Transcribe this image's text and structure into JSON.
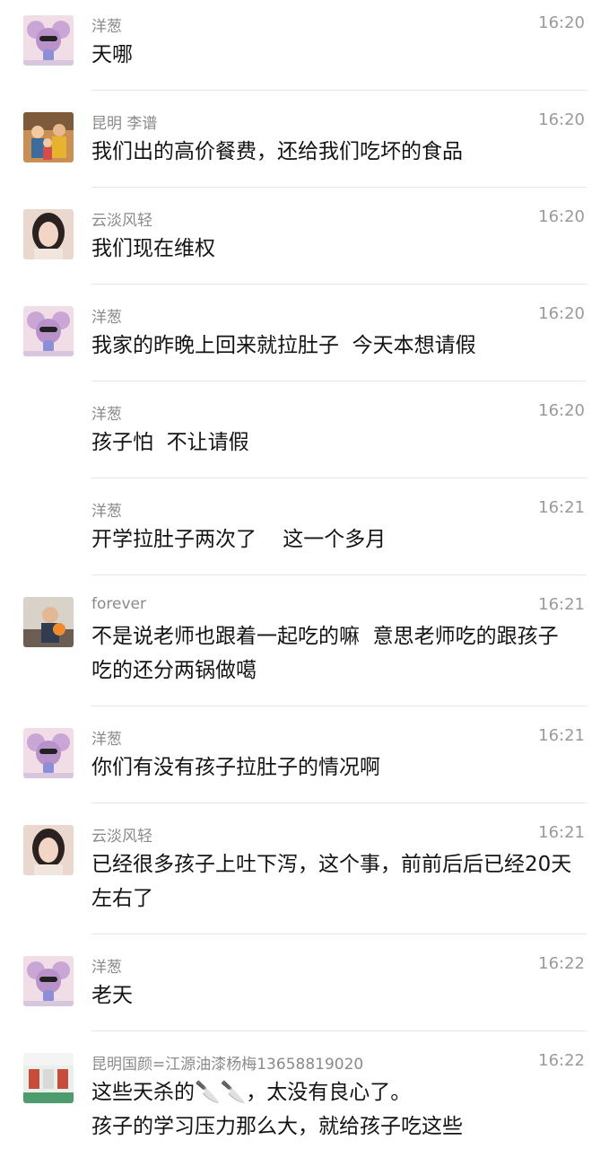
{
  "messages": [
    {
      "sender": "洋葱",
      "time": "16:20",
      "text": "天哪",
      "avatar": "mouse-avatar"
    },
    {
      "sender": "昆明 李谱",
      "time": "16:20",
      "text": "我们出的高价餐费，还给我们吃坏的食品",
      "avatar": "family-photo-avatar"
    },
    {
      "sender": "云淡风轻",
      "time": "16:20",
      "text": "我们现在维权",
      "avatar": "woman-photo-avatar"
    },
    {
      "sender": "洋葱",
      "time": "16:20",
      "text": "我家的昨晚上回来就拉肚子  今天本想请假",
      "avatar": "mouse-avatar"
    },
    {
      "sender": "洋葱",
      "time": "16:20",
      "text": "孩子怕  不让请假",
      "avatar": ""
    },
    {
      "sender": "洋葱",
      "time": "16:21",
      "text": "开学拉肚子两次了    这一个多月",
      "avatar": ""
    },
    {
      "sender": "forever",
      "time": "16:21",
      "text": "不是说老师也跟着一起吃的嘛  意思老师吃的跟孩子吃的还分两锅做噶",
      "avatar": "child-photo-avatar"
    },
    {
      "sender": "洋葱",
      "time": "16:21",
      "text": "你们有没有孩子拉肚子的情况啊",
      "avatar": "mouse-avatar"
    },
    {
      "sender": "云淡风轻",
      "time": "16:21",
      "text": "已经很多孩子上吐下泻，这个事，前前后后已经20天左右了",
      "avatar": "woman-photo-avatar"
    },
    {
      "sender": "洋葱",
      "time": "16:22",
      "text": "老天",
      "avatar": "mouse-avatar"
    },
    {
      "sender": "昆明国颜=江源油漆杨梅13658819020",
      "time": "16:22",
      "text": "这些天杀的🔪🔪，太没有良心了。\n孩子的学习压力那么大，就给孩子吃这些",
      "avatar": "paint-shop-avatar"
    }
  ]
}
